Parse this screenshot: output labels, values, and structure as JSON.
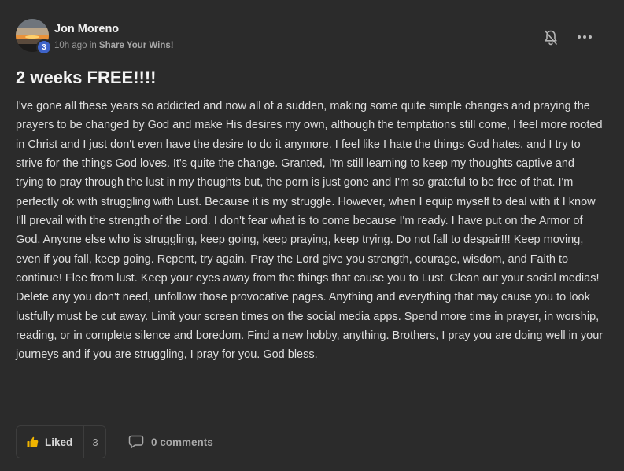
{
  "post": {
    "author": "Jon Moreno",
    "level": "3",
    "time": "10h ago",
    "in_word": " in ",
    "category": "Share Your Wins!",
    "title": "2 weeks FREE!!!!",
    "body": "I've gone all these years so addicted and now all of a sudden, making some quite simple changes and praying the prayers to be changed by God and make His desires my own, although the temptations still come, I feel more rooted in Christ and I just don't even have the desire to do it anymore. I feel like I hate the things God hates, and I try to strive for the things God loves. It's quite the change. Granted, I'm still learning to keep my thoughts captive and trying to pray through the lust in my thoughts but, the porn is just gone and I'm so grateful to be free of that. I'm perfectly ok with struggling with Lust. Because it is my struggle. However, when I equip myself to deal with it I know I'll prevail with the strength of the Lord. I don't fear what is to come because I'm ready. I have put on the Armor of God. Anyone else who is struggling, keep going, keep praying, keep trying. Do not fall to despair!!! Keep moving, even if you fall, keep going. Repent, try again. Pray the Lord give you strength, courage, wisdom, and Faith to continue! Flee from lust. Keep your eyes away from the things that cause you to Lust. Clean out your social medias! Delete any you don't need, unfollow those provocative pages. Anything and everything that may cause you to look lustfully must be cut away. Limit your screen times on the social media apps. Spend more time in prayer, in worship, reading, or in complete silence and boredom. Find a new hobby, anything. Brothers, I pray you are doing well in your journeys and if you are struggling, I pray for you. God bless."
  },
  "actions": {
    "like_label": "Liked",
    "like_count": "3",
    "comments_label": "0 comments"
  },
  "icons": {
    "like": "thumbs-up-icon",
    "comment": "comment-bubble-icon",
    "bell": "bell-off-icon",
    "more": "more-horizontal-icon"
  },
  "colors": {
    "background": "#2b2b2b",
    "level_badge": "#3e63c8",
    "like_icon": "#f0b400"
  }
}
